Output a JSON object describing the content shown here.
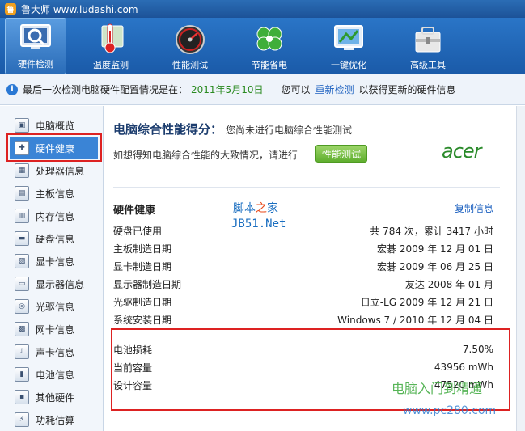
{
  "window": {
    "title": "鲁大师 www.ludashi.com"
  },
  "toolbar": {
    "items": [
      {
        "label": "硬件检测",
        "icon": "monitor-magnifier-icon"
      },
      {
        "label": "温度监测",
        "icon": "thermometer-icon"
      },
      {
        "label": "性能测试",
        "icon": "speedometer-icon"
      },
      {
        "label": "节能省电",
        "icon": "clover-icon"
      },
      {
        "label": "一键优化",
        "icon": "optimize-monitor-icon"
      },
      {
        "label": "高级工具",
        "icon": "toolbox-icon"
      }
    ]
  },
  "infobar": {
    "prefix": "最后一次检测电脑硬件配置情况是在：",
    "date": "2011年5月10日",
    "can": "您可以",
    "link": "重新检测",
    "suffix": "以获得更新的硬件信息"
  },
  "sidebar": {
    "items": [
      {
        "label": "电脑概览"
      },
      {
        "label": "硬件健康"
      },
      {
        "label": "处理器信息"
      },
      {
        "label": "主板信息"
      },
      {
        "label": "内存信息"
      },
      {
        "label": "硬盘信息"
      },
      {
        "label": "显卡信息"
      },
      {
        "label": "显示器信息"
      },
      {
        "label": "光驱信息"
      },
      {
        "label": "网卡信息"
      },
      {
        "label": "声卡信息"
      },
      {
        "label": "电池信息"
      },
      {
        "label": "其他硬件"
      },
      {
        "label": "功耗估算"
      }
    ]
  },
  "main": {
    "score_title": "电脑综合性能得分：",
    "score_note": "您尚未进行电脑综合性能测试",
    "score_sub": "如想得知电脑综合性能的大致情况，请进行",
    "perf_button": "性能测试",
    "brand": "acer",
    "hw_title": "硬件健康",
    "copy_link": "复制信息",
    "watermark1a": "脚本",
    "watermark1b": "之",
    "watermark1c": "家",
    "watermark2": "JB51.Net",
    "rows": [
      {
        "label": "硬盘已使用",
        "value": "共 784 次，累计 3417 小时"
      },
      {
        "label": "主板制造日期",
        "value": "宏碁 2009 年 12 月 01 日"
      },
      {
        "label": "显卡制造日期",
        "value": "宏碁 2009 年 06 月 25 日"
      },
      {
        "label": "显示器制造日期",
        "value": "友达 2008 年 01 月"
      },
      {
        "label": "光驱制造日期",
        "value": "日立-LG 2009 年 12 月 21 日"
      },
      {
        "label": "系统安装日期",
        "value": "Windows 7 / 2010 年 12 月 04 日"
      }
    ],
    "battery_rows": [
      {
        "label": "电池损耗",
        "value": "7.50%"
      },
      {
        "label": "当前容量",
        "value": "43956 mWh"
      },
      {
        "label": "设计容量",
        "value": "47520 mWh"
      }
    ],
    "watermark3": "电脑入门到精通",
    "watermark4": "www.pc280.com"
  },
  "colors": {
    "accent": "#2a75c7",
    "highlight": "#dd2222",
    "link": "#1a5fbf"
  }
}
